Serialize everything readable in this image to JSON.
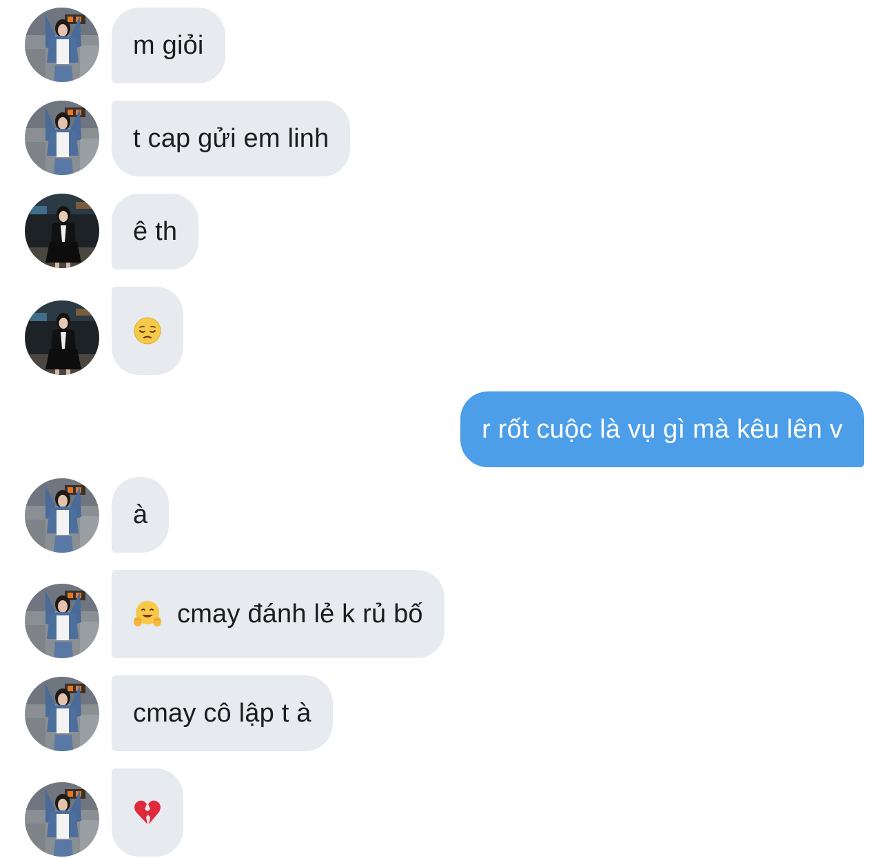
{
  "messages": [
    {
      "direction": "incoming",
      "sender": "friend-a",
      "text": "m giỏi"
    },
    {
      "direction": "incoming",
      "sender": "friend-a",
      "text": "t cap gửi em linh"
    },
    {
      "direction": "incoming",
      "sender": "friend-b",
      "text": "ê th"
    },
    {
      "direction": "incoming",
      "sender": "friend-b",
      "emoji": "pensive-face-emoji"
    },
    {
      "direction": "outgoing",
      "text": "r rốt cuộc là vụ gì mà kêu lên v"
    },
    {
      "direction": "incoming",
      "sender": "friend-a",
      "text": "à"
    },
    {
      "direction": "incoming",
      "sender": "friend-a",
      "emoji": "hugging-face-emoji",
      "text": "cmay đánh lẻ k rủ bố"
    },
    {
      "direction": "incoming",
      "sender": "friend-a",
      "text": "cmay cô lập t à"
    },
    {
      "direction": "incoming",
      "sender": "friend-a",
      "emoji": "broken-heart-emoji"
    }
  ],
  "colors": {
    "incoming_bubble": "#e7eaee",
    "outgoing_bubble": "#4c9ee8",
    "incoming_text": "#1c1c1e",
    "outgoing_text": "#ffffff"
  }
}
